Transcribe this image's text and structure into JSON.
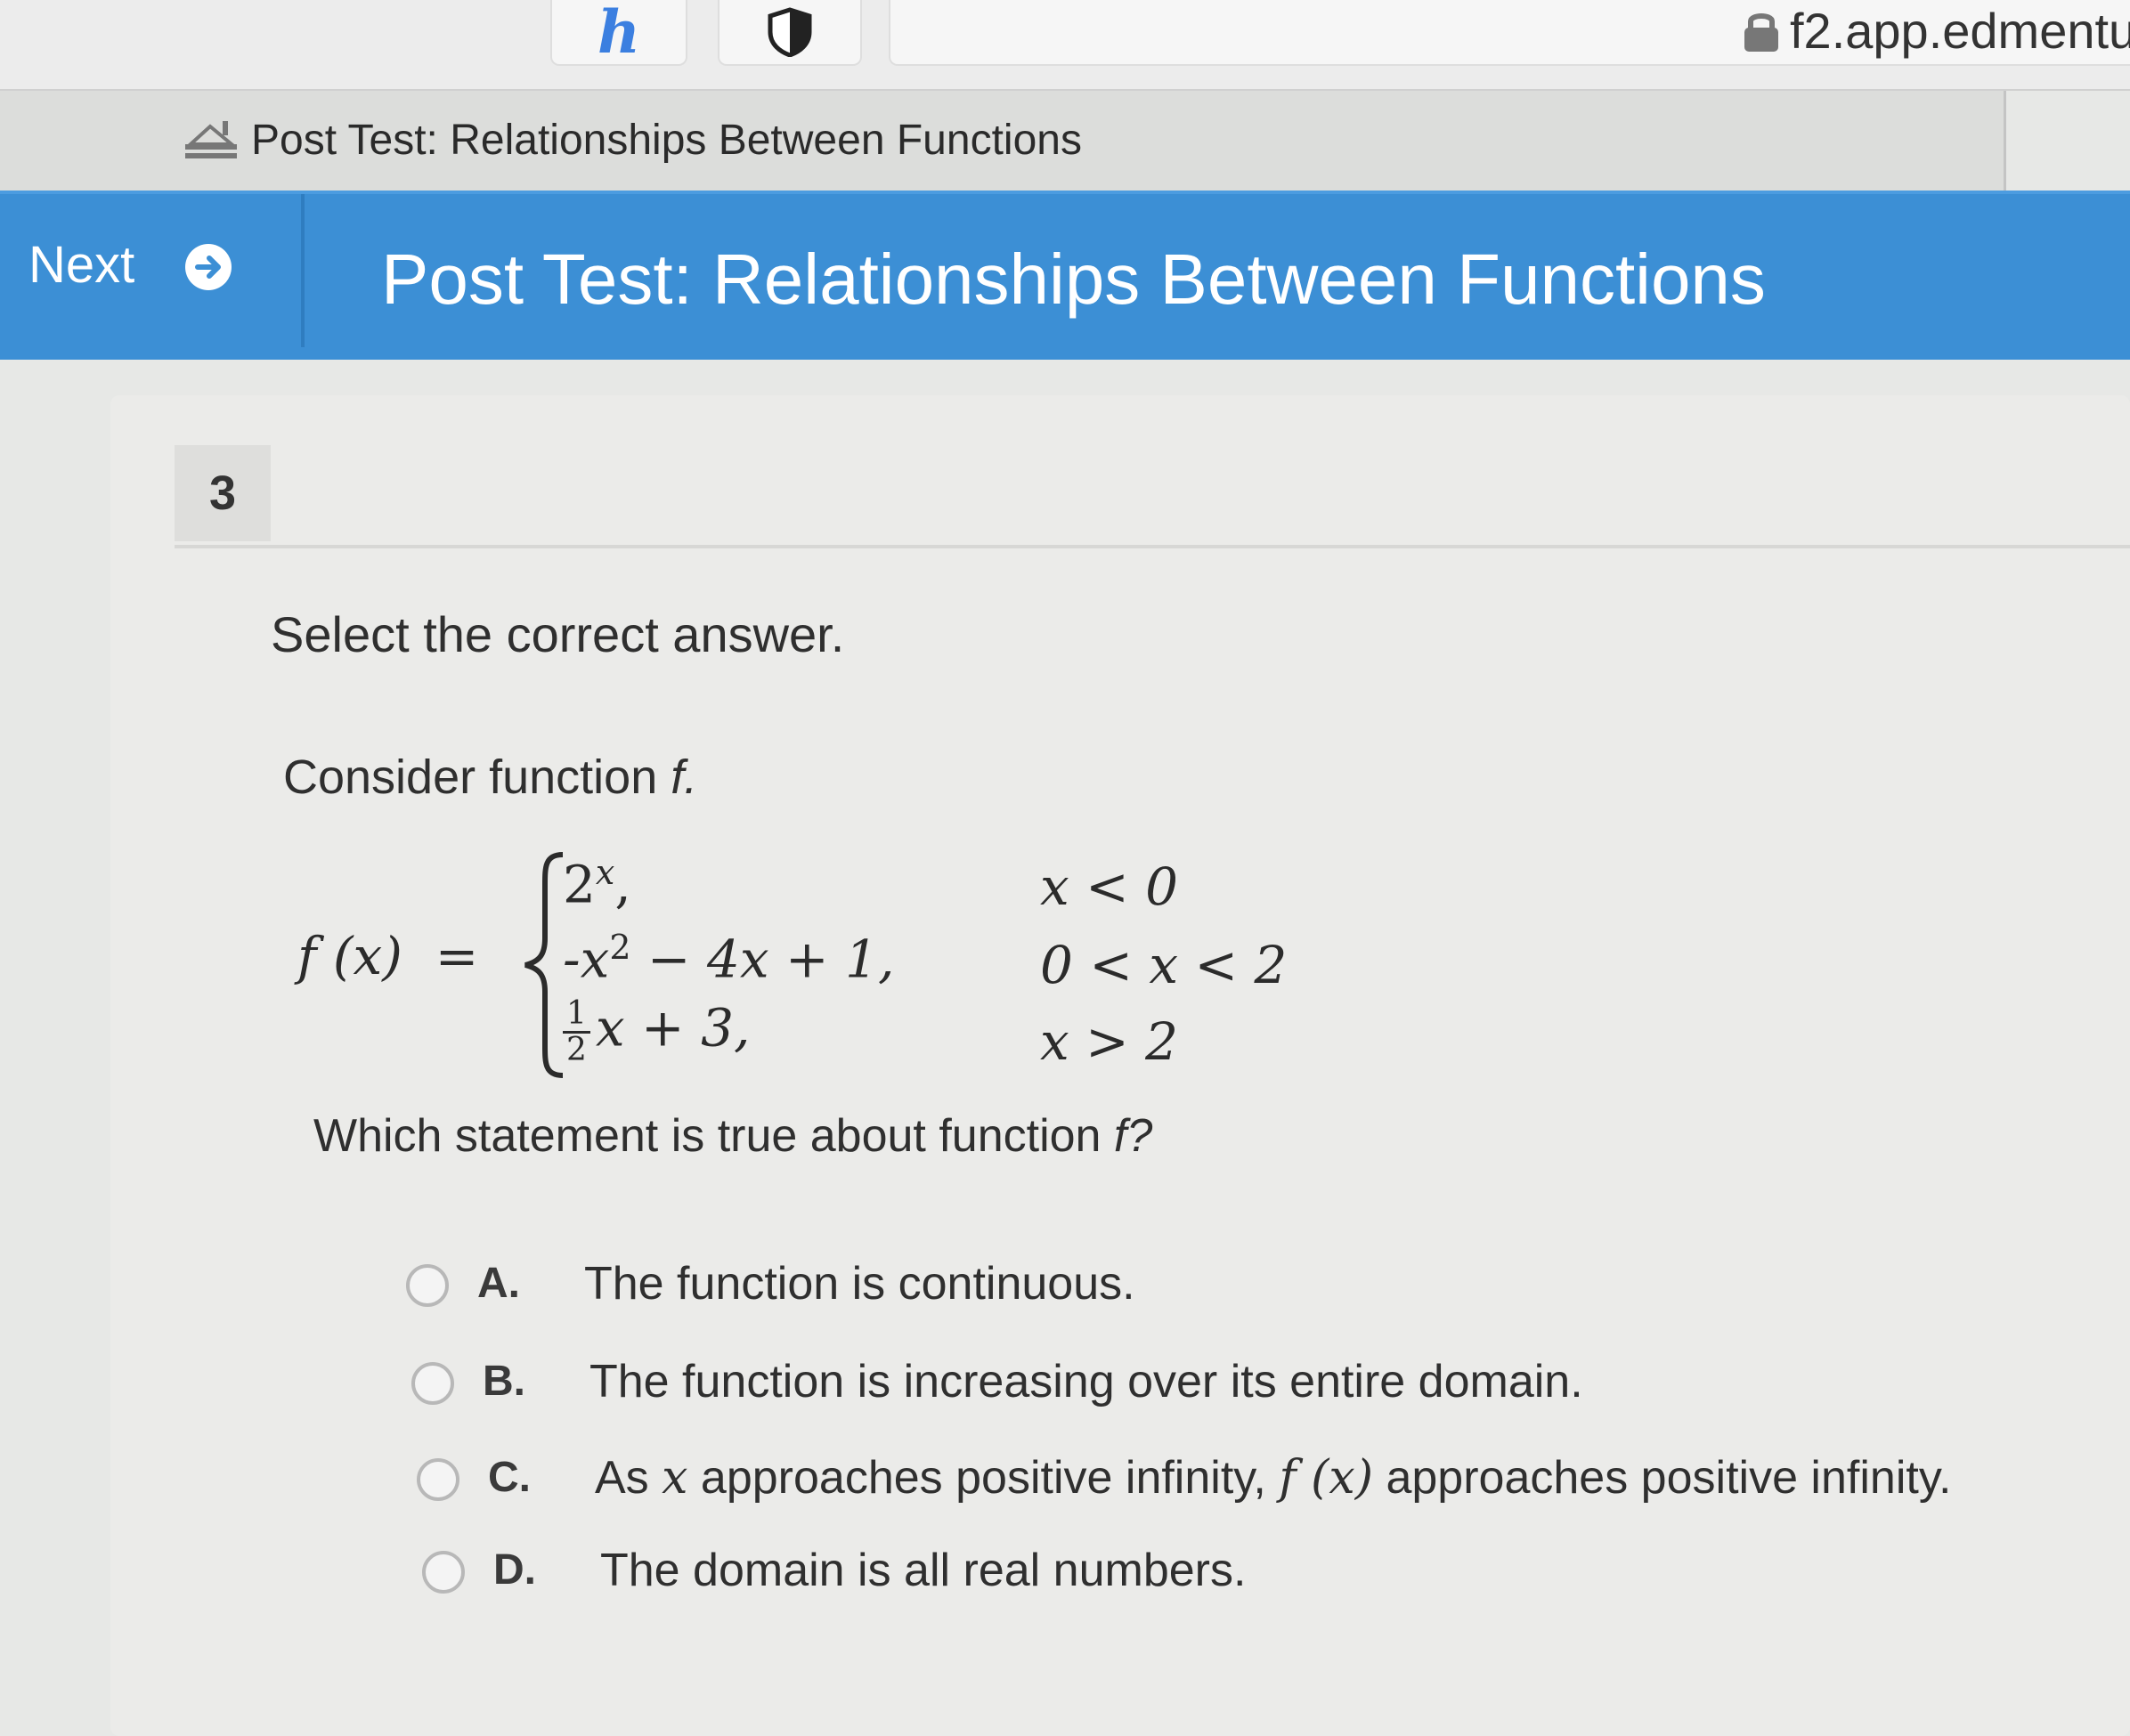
{
  "browser": {
    "url": "f2.app.edmentu"
  },
  "window": {
    "title": "Post Test: Relationships Between Functions"
  },
  "header": {
    "next_label": "Next",
    "title": "Post Test: Relationships Between Functions"
  },
  "question": {
    "number": "3",
    "instruction": "Select the correct answer.",
    "intro": "Consider function",
    "intro_var": "f.",
    "function": {
      "lhs": "f (x)",
      "equals": "=",
      "cases": [
        {
          "expr_base": "2",
          "expr_sup": "x",
          "expr_rest": ",",
          "condition": "x < 0"
        },
        {
          "expr_base": "-x",
          "expr_sup": "2",
          "expr_rest": " − 4x + 1,",
          "condition": "0 < x < 2"
        },
        {
          "frac_num": "1",
          "frac_den": "2",
          "expr_rest": "x + 3,",
          "condition": "x > 2"
        }
      ]
    },
    "prompt": "Which statement is true about function",
    "prompt_var": "f?",
    "options": [
      {
        "letter": "A.",
        "text": "The function is continuous."
      },
      {
        "letter": "B.",
        "text": "The function is increasing over its entire domain."
      },
      {
        "letter": "C.",
        "text_before": "As",
        "text_var": "x",
        "text_mid": "approaches positive infinity,",
        "text_fx": "f (x)",
        "text_after": "approaches positive infinity."
      },
      {
        "letter": "D.",
        "text": "The domain is all real numbers."
      }
    ]
  },
  "colors": {
    "header_blue": "#3c8fd5",
    "text": "#2f2f2f",
    "radio_border": "#b8b8b8"
  }
}
